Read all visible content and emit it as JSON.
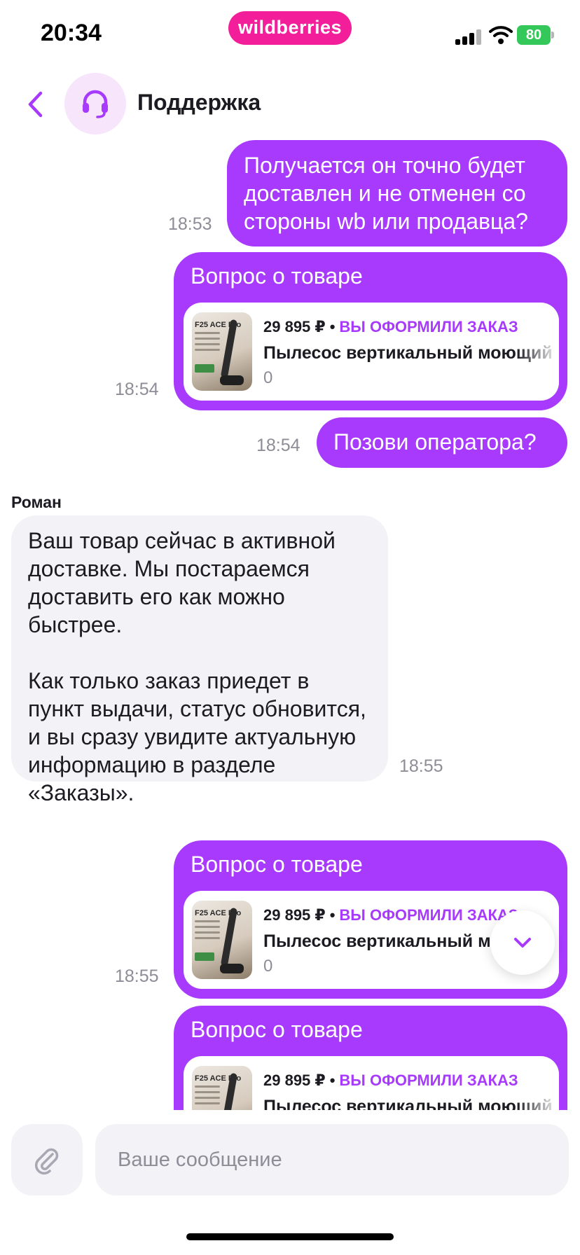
{
  "status_bar": {
    "time": "20:34",
    "brand": "wildberries",
    "battery": "80"
  },
  "header": {
    "title": "Поддержка"
  },
  "messages": [
    {
      "kind": "out-text",
      "text": "Получается он точно будет доставлен и не отменен со стороны wb или продавца?",
      "time": "18:53"
    },
    {
      "kind": "out-product",
      "title": "Вопрос о товаре",
      "thumb_label": "F25 ACE Pro",
      "price": "29 895 ₽",
      "status": "ВЫ ОФОРМИЛИ ЗАКАЗ",
      "name": "Пылесос вертикальный моющий",
      "qty": "0",
      "time": "18:54"
    },
    {
      "kind": "out-text",
      "text": "Позови оператора?",
      "time": "18:54"
    },
    {
      "kind": "in-text",
      "sender": "Роман",
      "text": "Ваш товар сейчас в активной доставке. Мы постараемся доставить его как можно быстрее.\n\nКак только заказ приедет в пункт выдачи, статус обновится, и вы сразу увидите актуальную информацию в разделе «Заказы».",
      "time": "18:55"
    },
    {
      "kind": "out-product",
      "title": "Вопрос о товаре",
      "thumb_label": "F25 ACE Pro",
      "price": "29 895 ₽",
      "status": "ВЫ ОФОРМИЛИ ЗАКАЗ",
      "name": "Пылесос вертикальный моющий",
      "qty": "0",
      "time": "18:55"
    },
    {
      "kind": "out-product",
      "title": "Вопрос о товаре",
      "thumb_label": "F25 ACE Pro",
      "price": "29 895 ₽",
      "status": "ВЫ ОФОРМИЛИ ЗАКАЗ",
      "name": "Пылесос вертикальный моющий",
      "qty": "",
      "time": ""
    }
  ],
  "composer": {
    "placeholder": "Ваше сообщение"
  },
  "colors": {
    "accent": "#a73afd",
    "brand": "#f21e9a",
    "incoming_bubble": "#f3f2f7"
  },
  "icons": [
    "back-chevron-icon",
    "headset-icon",
    "signal-icon",
    "wifi-icon",
    "battery-icon",
    "chevron-down-icon",
    "paperclip-icon"
  ]
}
